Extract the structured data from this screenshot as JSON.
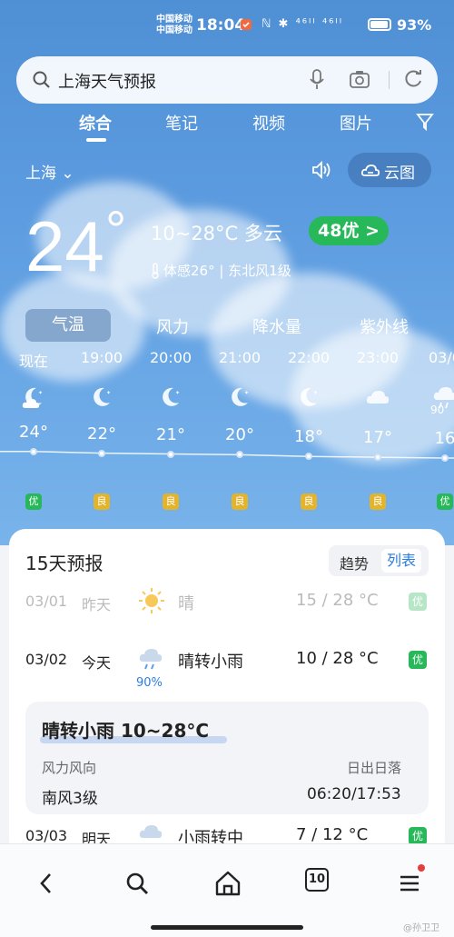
{
  "status_bar": {
    "carrier1": "中国移动",
    "carrier2": "中国移动",
    "time": "18:04",
    "signal_text": "ℕ ✱ ⁴⁶ᴵᴵ ⁴⁶ᴵᴵ",
    "battery_percent": "93%",
    "battery_level": 0.93
  },
  "search": {
    "query": "上海天气预报"
  },
  "tabs": [
    {
      "label": "综合",
      "active": true
    },
    {
      "label": "笔记"
    },
    {
      "label": "视频"
    },
    {
      "label": "图片"
    }
  ],
  "location": {
    "city": "上海 ⌄"
  },
  "radar": {
    "label": "云图"
  },
  "current": {
    "temp": "24",
    "deg": "°",
    "range_condition": "10~28°C 多云",
    "aqi": "48优 >",
    "feels_wind": "体感26° | 东北风1级"
  },
  "metric_tabs": [
    "气温",
    "风力",
    "降水量",
    "紫外线"
  ],
  "hourly": [
    {
      "time": "现在",
      "icon": "moon-cloud-icon",
      "temp": "24°",
      "aqi": "优",
      "aqi_color": "#27b85a"
    },
    {
      "time": "19:00",
      "icon": "moon-icon",
      "temp": "22°",
      "aqi": "良",
      "aqi_color": "#e2b32b"
    },
    {
      "time": "20:00",
      "icon": "moon-icon",
      "temp": "21°",
      "aqi": "良",
      "aqi_color": "#e2b32b"
    },
    {
      "time": "21:00",
      "icon": "moon-icon",
      "temp": "20°",
      "aqi": "良",
      "aqi_color": "#e2b32b"
    },
    {
      "time": "22:00",
      "icon": "moon-icon",
      "temp": "18°",
      "aqi": "良",
      "aqi_color": "#e2b32b"
    },
    {
      "time": "23:00",
      "icon": "cloud-icon",
      "temp": "17°",
      "aqi": "良",
      "aqi_color": "#e2b32b"
    },
    {
      "time": "03/0",
      "icon": "rain-icon",
      "temp": "16",
      "aqi": "优",
      "aqi_color": "#27b85a"
    }
  ],
  "hourly_extra": {
    "pop": "90"
  },
  "forecast": {
    "title": "15天预报",
    "toggle": [
      "趋势",
      "列表"
    ],
    "rows": [
      {
        "date": "03/01",
        "day": "昨天",
        "icon": "sun-icon",
        "cond": "晴",
        "range": "15 / 28 °C",
        "aqi": "优"
      },
      {
        "date": "03/02",
        "day": "今天",
        "icon": "rain-cloud-icon",
        "pop": "90%",
        "cond": "晴转小雨",
        "range": "10 / 28 °C",
        "aqi": "优"
      },
      {
        "date": "03/03",
        "day": "明天",
        "icon": "rain-cloud-icon",
        "cond": "小雨转中",
        "range": "7 / 12 °C",
        "aqi": "优"
      }
    ],
    "detail": {
      "title": "晴转小雨 10~28°C",
      "wind_label": "风力风向",
      "wind_value": "南风3级",
      "sun_label": "日出日落",
      "sun_value": "06:20/17:53"
    }
  },
  "bottom_nav": {
    "tab_count": "10"
  },
  "watermark": "@孙卫卫"
}
